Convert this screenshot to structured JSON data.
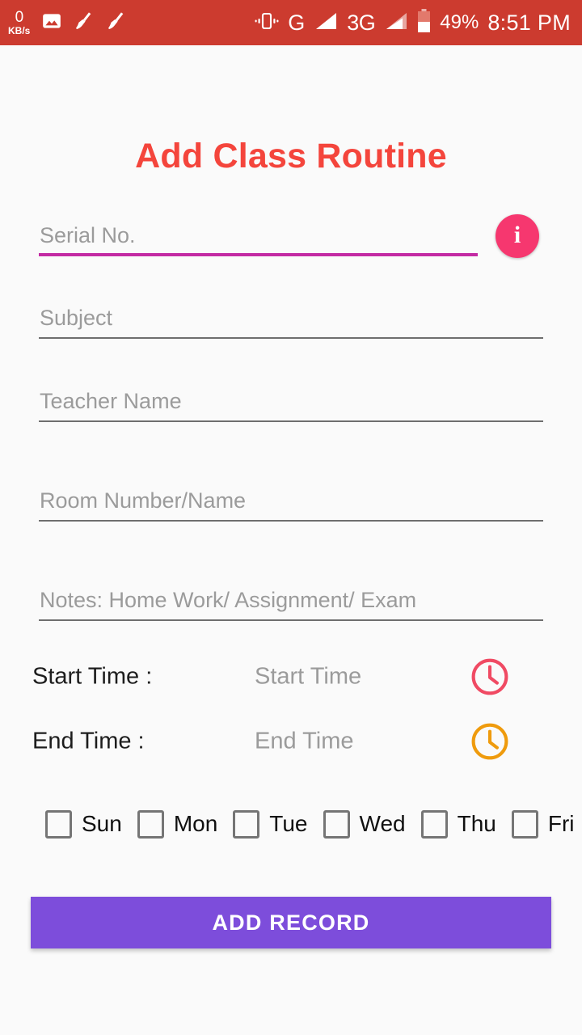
{
  "status_bar": {
    "background_color": "#cc3b2f",
    "network_speed_value": "0",
    "network_speed_unit": "KB/s",
    "icons": [
      "gallery-icon",
      "cleaner-broom-icon",
      "cleaner-broom-icon",
      "vibrate-icon"
    ],
    "network_type_1": "G",
    "network_type_2": "3G",
    "battery_percent": "49%",
    "time": "8:51 PM"
  },
  "header": {
    "title": "Add Class Routine",
    "title_color": "#f4453c"
  },
  "form": {
    "fields": [
      {
        "name": "serial-no",
        "placeholder": "Serial No.",
        "value": "",
        "focused": true,
        "underline_color": "#c32aa3"
      },
      {
        "name": "subject",
        "placeholder": "Subject",
        "value": "",
        "focused": false,
        "underline_color": "#6e6e6e"
      },
      {
        "name": "teacher-name",
        "placeholder": "Teacher Name",
        "value": "",
        "focused": false,
        "underline_color": "#6e6e6e"
      },
      {
        "name": "room-number",
        "placeholder": "Room Number/Name",
        "value": "",
        "focused": false,
        "underline_color": "#6e6e6e"
      },
      {
        "name": "notes",
        "placeholder": "Notes: Home Work/ Assignment/ Exam",
        "value": "",
        "focused": false,
        "underline_color": "#6e6e6e"
      }
    ],
    "info_button": {
      "icon": "info-icon",
      "glyph": "i",
      "color": "#f6376f"
    }
  },
  "time_pickers": [
    {
      "label": "Start Time :",
      "value": "Start Time",
      "icon": "clock-icon",
      "icon_color": "#f04a63"
    },
    {
      "label": "End Time :",
      "value": "End Time",
      "icon": "clock-icon",
      "icon_color": "#ef9b0d"
    }
  ],
  "days": [
    {
      "label": "Sun",
      "checked": false
    },
    {
      "label": "Mon",
      "checked": false
    },
    {
      "label": "Tue",
      "checked": false
    },
    {
      "label": "Wed",
      "checked": false
    },
    {
      "label": "Thu",
      "checked": false
    },
    {
      "label": "Fri",
      "checked": false
    }
  ],
  "submit": {
    "label": "ADD RECORD",
    "color": "#7d4ddb"
  }
}
